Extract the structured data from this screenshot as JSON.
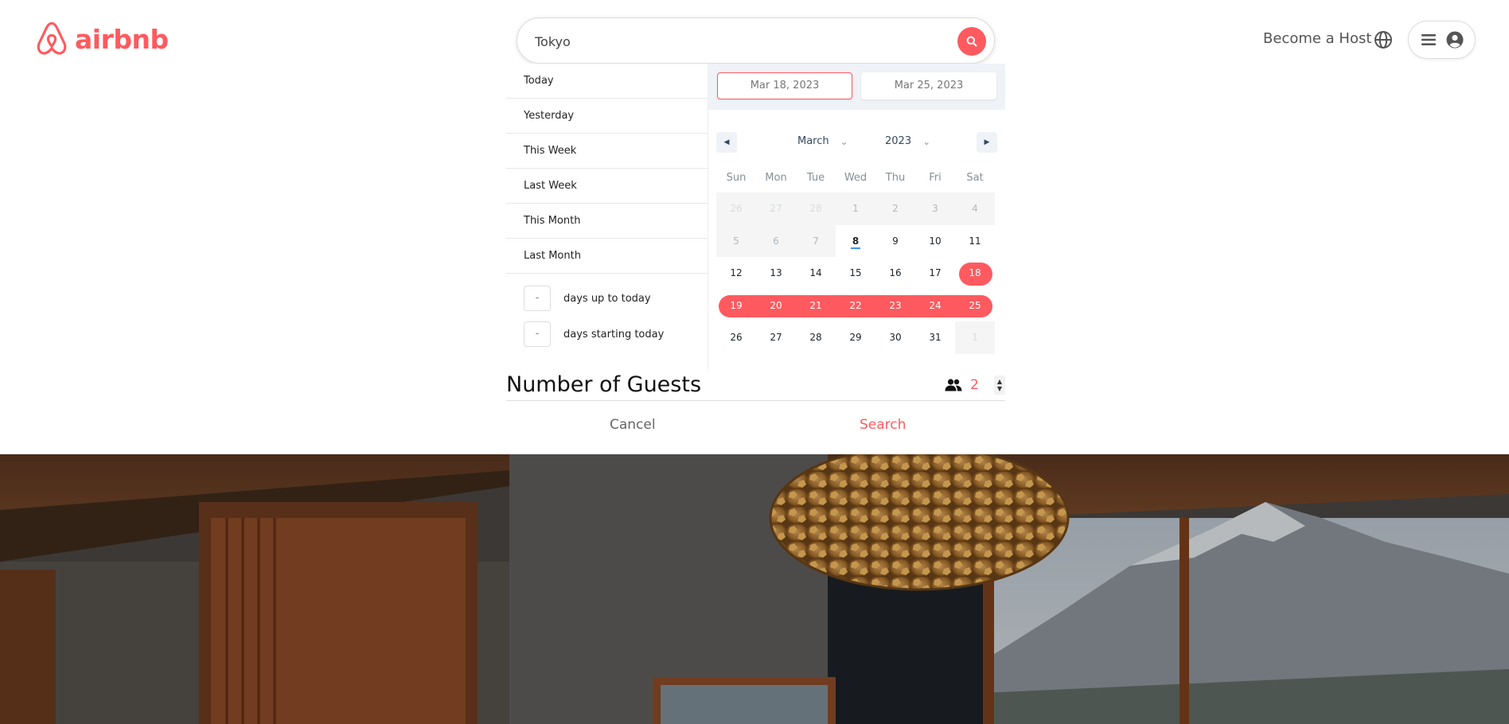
{
  "brand": {
    "name": "airbnb",
    "color": "#ff5a5f"
  },
  "search": {
    "value": "Tokyo",
    "placeholder": ""
  },
  "nav": {
    "become_host": "Become a Host",
    "globe_icon": "globe-icon",
    "menu_icon": "hamburger-icon",
    "avatar_icon": "user-circle-icon"
  },
  "date_ranges": {
    "static": [
      "Today",
      "Yesterday",
      "This Week",
      "Last Week",
      "This Month",
      "Last Month"
    ],
    "inputs": [
      {
        "value": "-",
        "label": "days up to today"
      },
      {
        "value": "-",
        "label": "days starting today"
      }
    ]
  },
  "calendar": {
    "start_date": "Mar 18, 2023",
    "end_date": "Mar 25, 2023",
    "month": "March",
    "year": "2023",
    "weekdays": [
      "Sun",
      "Mon",
      "Tue",
      "Wed",
      "Thu",
      "Fri",
      "Sat"
    ],
    "days": [
      {
        "d": "26",
        "s": "passive"
      },
      {
        "d": "27",
        "s": "passive"
      },
      {
        "d": "28",
        "s": "passive"
      },
      {
        "d": "1",
        "s": "disabled"
      },
      {
        "d": "2",
        "s": "disabled"
      },
      {
        "d": "3",
        "s": "disabled"
      },
      {
        "d": "4",
        "s": "disabled"
      },
      {
        "d": "5",
        "s": "disabled"
      },
      {
        "d": "6",
        "s": "disabled"
      },
      {
        "d": "7",
        "s": "disabled"
      },
      {
        "d": "8",
        "s": "today"
      },
      {
        "d": "9",
        "s": ""
      },
      {
        "d": "10",
        "s": ""
      },
      {
        "d": "11",
        "s": ""
      },
      {
        "d": "12",
        "s": ""
      },
      {
        "d": "13",
        "s": ""
      },
      {
        "d": "14",
        "s": ""
      },
      {
        "d": "15",
        "s": ""
      },
      {
        "d": "16",
        "s": ""
      },
      {
        "d": "17",
        "s": ""
      },
      {
        "d": "18",
        "s": "sel-start"
      },
      {
        "d": "19",
        "s": "in-range first"
      },
      {
        "d": "20",
        "s": "in-range"
      },
      {
        "d": "21",
        "s": "in-range"
      },
      {
        "d": "22",
        "s": "in-range"
      },
      {
        "d": "23",
        "s": "in-range"
      },
      {
        "d": "24",
        "s": "in-range"
      },
      {
        "d": "25",
        "s": "in-range last"
      },
      {
        "d": "26",
        "s": ""
      },
      {
        "d": "27",
        "s": ""
      },
      {
        "d": "28",
        "s": ""
      },
      {
        "d": "29",
        "s": ""
      },
      {
        "d": "30",
        "s": ""
      },
      {
        "d": "31",
        "s": ""
      },
      {
        "d": "1",
        "s": "passive"
      }
    ]
  },
  "guests": {
    "title": "Number of Guests",
    "count": "2",
    "icon": "people-icon"
  },
  "actions": {
    "cancel": "Cancel",
    "search": "Search"
  },
  "hero": {
    "description_icon": "hero-photo"
  }
}
